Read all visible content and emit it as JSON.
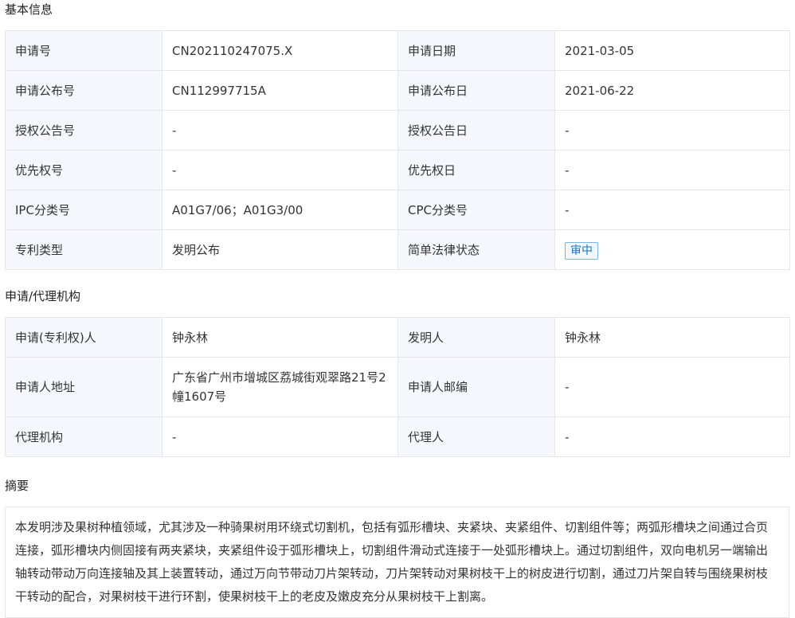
{
  "basic": {
    "title": "基本信息",
    "rows": [
      [
        "申请号",
        "CN202110247075.X",
        "申请日期",
        "2021-03-05"
      ],
      [
        "申请公布号",
        "CN112997715A",
        "申请公布日",
        "2021-06-22"
      ],
      [
        "授权公告号",
        "-",
        "授权公告日",
        "-"
      ],
      [
        "优先权号",
        "-",
        "优先权日",
        "-"
      ],
      [
        "IPC分类号",
        "A01G7/06；A01G3/00",
        "CPC分类号",
        "-"
      ],
      [
        "专利类型",
        "发明公布",
        "简单法律状态",
        "审中"
      ]
    ]
  },
  "agency": {
    "title": "申请/代理机构",
    "rows": [
      [
        "申请(专利权)人",
        "钟永林",
        "发明人",
        "钟永林"
      ],
      [
        "申请人地址",
        "广东省广州市增城区荔城街观翠路21号2幢1607号",
        "申请人邮编",
        "-"
      ],
      [
        "代理机构",
        "-",
        "代理人",
        "-"
      ]
    ]
  },
  "abstract": {
    "title": "摘要",
    "text": "本发明涉及果树种植领域，尤其涉及一种骑果树用环绕式切割机，包括有弧形槽块、夹紧块、夹紧组件、切割组件等；两弧形槽块之间通过合页连接，弧形槽块内侧固接有两夹紧块，夹紧组件设于弧形槽块上，切割组件滑动式连接于一处弧形槽块上。通过切割组件，双向电机另一端输出轴转动带动万向连接轴及其上装置转动，通过万向节带动刀片架转动，刀片架转动对果树枝干上的树皮进行切割，通过刀片架自转与围绕果树枝干转动的配合，对果树枝干进行环割，使果树枝干上的老皮及嫩皮充分从果树枝干上割离。"
  },
  "colors": {
    "label_bg": "#f4f8fc",
    "border": "#e6e6e6",
    "badge_text": "#1a73c7",
    "badge_border": "#79b4e8"
  }
}
